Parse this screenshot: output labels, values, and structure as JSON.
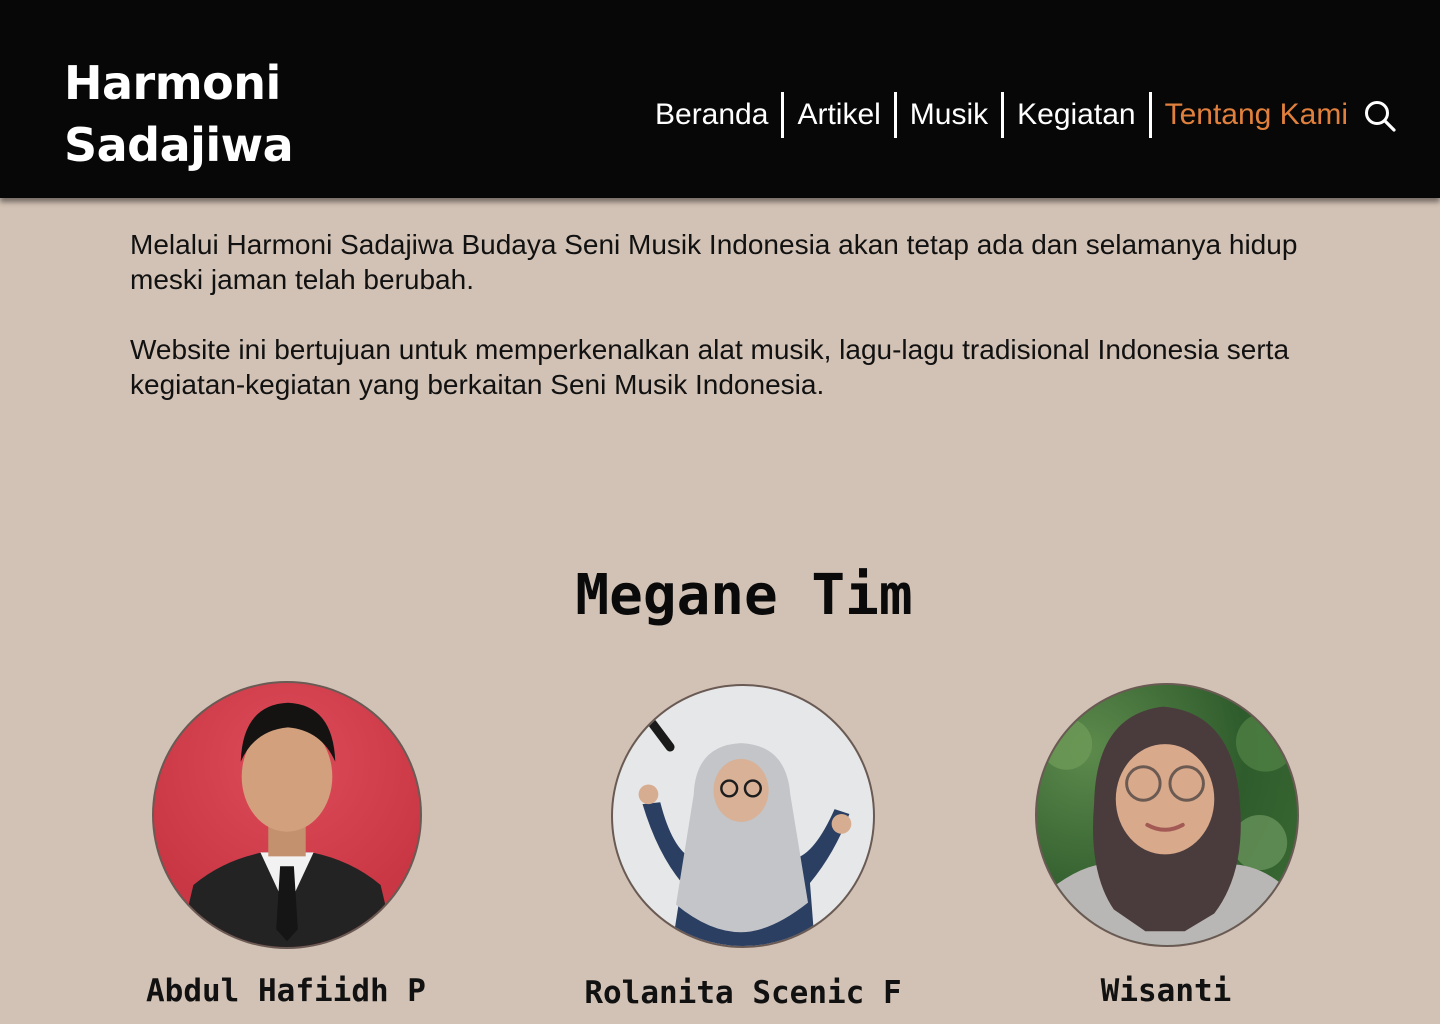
{
  "brand": {
    "line1": "Harmoni",
    "line2": "Sadajiwa"
  },
  "nav": {
    "items": [
      {
        "label": "Beranda",
        "active": false
      },
      {
        "label": "Artikel",
        "active": false
      },
      {
        "label": "Musik",
        "active": false
      },
      {
        "label": "Kegiatan",
        "active": false
      },
      {
        "label": "Tentang Kami",
        "active": true
      }
    ],
    "search_icon": "search-icon"
  },
  "intro": {
    "paragraph1": "Melalui Harmoni Sadajiwa Budaya Seni Musik Indonesia akan tetap ada dan selamanya hidup meski jaman telah berubah.",
    "paragraph2": "Website ini bertujuan untuk memperkenalkan alat musik,  lagu-lagu tradisional Indonesia serta kegiatan-kegiatan yang berkaitan Seni Musik Indonesia."
  },
  "team": {
    "title": "Megane Tim",
    "members": [
      {
        "name": "Abdul Hafiidh P"
      },
      {
        "name": "Rolanita Scenic F"
      },
      {
        "name": "Wisanti"
      }
    ]
  },
  "colors": {
    "header_bg": "#070707",
    "page_bg": "#D2C2B5",
    "active_nav": "#E0803C",
    "text": "#111111"
  }
}
